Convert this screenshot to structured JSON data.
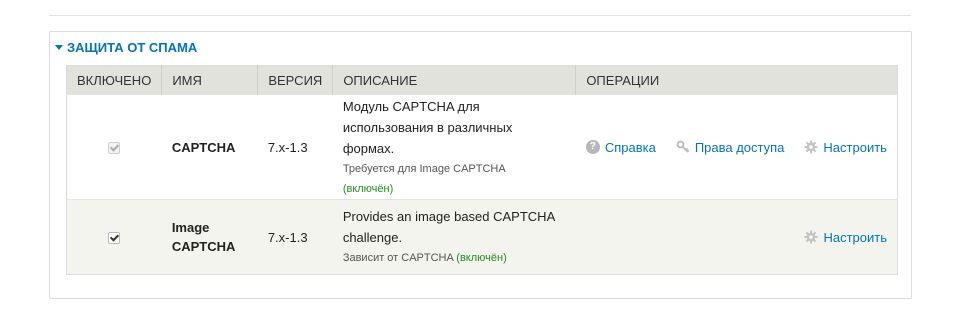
{
  "section": {
    "title": "ЗАЩИТА ОТ СПАМА"
  },
  "table": {
    "headers": {
      "enabled": "ВКЛЮЧЕНО",
      "name": "ИМЯ",
      "version": "ВЕРСИЯ",
      "description": "ОПИСАНИЕ",
      "operations": "ОПЕРАЦИИ"
    },
    "rows": [
      {
        "enabled": true,
        "disabled_checkbox": true,
        "name": "CAPTCHA",
        "version": "7.x-1.3",
        "description_line1": "Модуль CAPTCHA для",
        "description_line2": "использования в различных формах.",
        "requires_prefix": "Требуется для Image CAPTCHA",
        "requires_status": "(включён)",
        "ops": {
          "help": "Справка",
          "permissions": "Права доступа",
          "configure": "Настроить"
        }
      },
      {
        "enabled": true,
        "disabled_checkbox": false,
        "name_line1": "Image",
        "name_line2": "CAPTCHA",
        "version": "7.x-1.3",
        "description_line1": "Provides an image based CAPTCHA",
        "description_line2": "challenge.",
        "depends_prefix": "Зависит от CAPTCHA",
        "depends_status": "(включён)",
        "ops": {
          "configure": "Настроить"
        }
      }
    ]
  },
  "colors": {
    "link": "#0074bd",
    "enabled_status": "#208e1c",
    "header_bg": "#e1e2dc",
    "alt_row_bg": "#f3f4ee"
  },
  "icons": {
    "legend": "caret-down-icon",
    "help": "question-circle-icon",
    "permissions": "key-icon",
    "configure": "gear-icon"
  }
}
